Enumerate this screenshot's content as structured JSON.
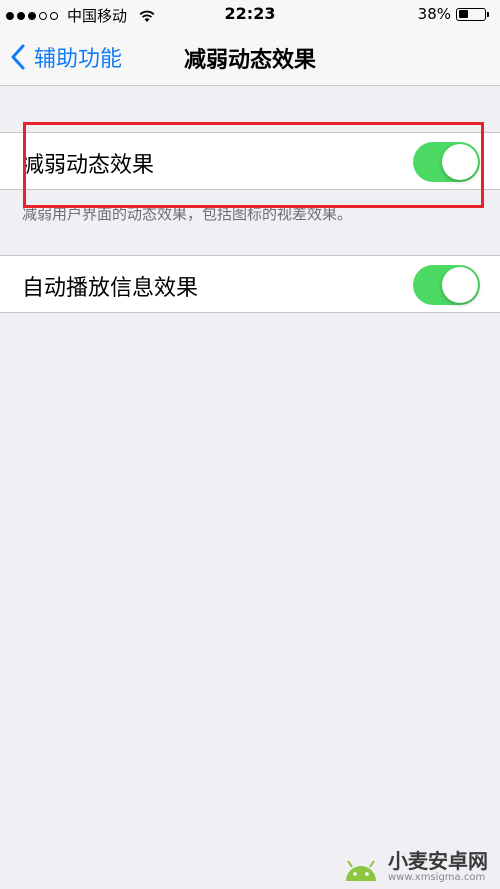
{
  "status_bar": {
    "carrier": "中国移动",
    "time": "22:23",
    "battery": "38%",
    "battery_level": 0.38
  },
  "nav": {
    "back_label": "辅助功能",
    "title": "减弱动态效果"
  },
  "settings": {
    "reduce_motion": {
      "label": "减弱动态效果",
      "on": true
    },
    "reduce_motion_footer": "减弱用户界面的动态效果，包括图标的视差效果。",
    "auto_play_effects": {
      "label": "自动播放信息效果",
      "on": true
    }
  },
  "colors": {
    "accent": "#137cf5",
    "switch_on": "#4cd964",
    "highlight": "#e8232a",
    "background": "#efeff4"
  },
  "watermark": {
    "title": "小麦安卓网",
    "url": "www.xmsigma.com"
  }
}
